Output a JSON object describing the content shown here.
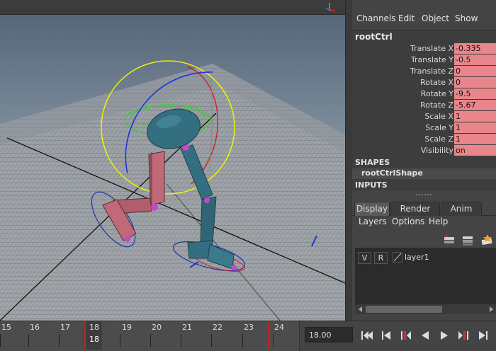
{
  "channel_box": {
    "menu": [
      "Channels",
      "Edit",
      "Object",
      "Show"
    ],
    "node_name": "rootCtrl",
    "attributes": [
      {
        "label": "Translate X",
        "value": "-0.335"
      },
      {
        "label": "Translate Y",
        "value": "-0.5"
      },
      {
        "label": "Translate Z",
        "value": "0"
      },
      {
        "label": "Rotate X",
        "value": "0"
      },
      {
        "label": "Rotate Y",
        "value": "-9.5"
      },
      {
        "label": "Rotate Z",
        "value": "-5.67"
      },
      {
        "label": "Scale X",
        "value": "1"
      },
      {
        "label": "Scale Y",
        "value": "1"
      },
      {
        "label": "Scale Z",
        "value": "1"
      },
      {
        "label": "Visibility",
        "value": "on"
      }
    ],
    "shapes_label": "SHAPES",
    "shape_name": "rootCtrlShape",
    "inputs_label": "INPUTS",
    "keyed_color": "#e8868c"
  },
  "layer_editor": {
    "tabs": [
      "Display",
      "Render",
      "Anim"
    ],
    "active_tab": "Display",
    "menu": [
      "Layers",
      "Options",
      "Help"
    ],
    "layer": {
      "v": "V",
      "r": "R",
      "name": "layer1"
    }
  },
  "timeline": {
    "ticks": [
      "15",
      "16",
      "17",
      "18",
      "19",
      "20",
      "21",
      "22",
      "23",
      "24"
    ],
    "current_frame_label": "18",
    "current_frame_field": "18.00"
  },
  "viewport": {
    "background_top": "#5b6d80",
    "background_bottom": "#a5afba",
    "character_color": "#336f80",
    "left_leg_color": "#c06a79",
    "control_circle_color": "#f2f200"
  }
}
